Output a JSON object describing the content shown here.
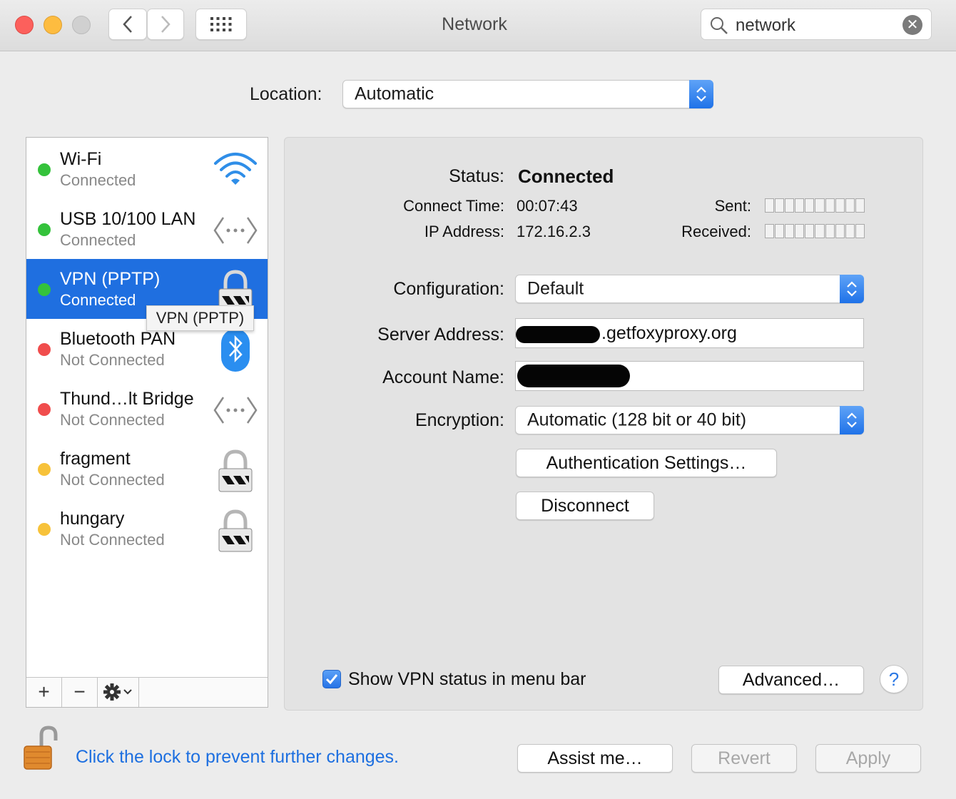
{
  "window": {
    "title": "Network"
  },
  "search": {
    "value": "network"
  },
  "location": {
    "label": "Location:",
    "value": "Automatic"
  },
  "services": [
    {
      "name": "Wi-Fi",
      "status": "Connected",
      "status_color": "#34c23b",
      "icon": "wifi-icon"
    },
    {
      "name": "USB 10/100 LAN",
      "status": "Connected",
      "status_color": "#34c23b",
      "icon": "ethernet-icon"
    },
    {
      "name": "VPN (PPTP)",
      "status": "Connected",
      "status_color": "#34c23b",
      "icon": "vpn-lock-icon",
      "selected": true
    },
    {
      "name": "Bluetooth PAN",
      "status": "Not Connected",
      "status_color": "#f04d4d",
      "icon": "bluetooth-icon"
    },
    {
      "name": "Thund…lt Bridge",
      "status": "Not Connected",
      "status_color": "#f04d4d",
      "icon": "ethernet-icon"
    },
    {
      "name": "fragment",
      "status": "Not Connected",
      "status_color": "#f7c23a",
      "icon": "vpn-lock-icon"
    },
    {
      "name": "hungary",
      "status": "Not Connected",
      "status_color": "#f7c23a",
      "icon": "vpn-lock-icon"
    }
  ],
  "tooltip": {
    "text": "VPN (PPTP)"
  },
  "sidebar_tools": {
    "add": "+",
    "remove": "−"
  },
  "detail": {
    "status_label": "Status:",
    "status_value": "Connected",
    "connect_time_label": "Connect Time:",
    "connect_time_value": "00:07:43",
    "ip_label": "IP Address:",
    "ip_value": "172.16.2.3",
    "sent_label": "Sent:",
    "received_label": "Received:",
    "configuration_label": "Configuration:",
    "configuration_value": "Default",
    "server_label": "Server Address:",
    "server_value": ".getfoxyproxy.org",
    "account_label": "Account Name:",
    "encryption_label": "Encryption:",
    "encryption_value": "Automatic (128 bit or 40 bit)",
    "auth_button": "Authentication Settings…",
    "disconnect_button": "Disconnect",
    "show_status_label": "Show VPN status in menu bar",
    "advanced_button": "Advanced…",
    "help": "?"
  },
  "footer": {
    "lock_text": "Click the lock to prevent further changes.",
    "assist_button": "Assist me…",
    "revert_button": "Revert",
    "apply_button": "Apply"
  }
}
